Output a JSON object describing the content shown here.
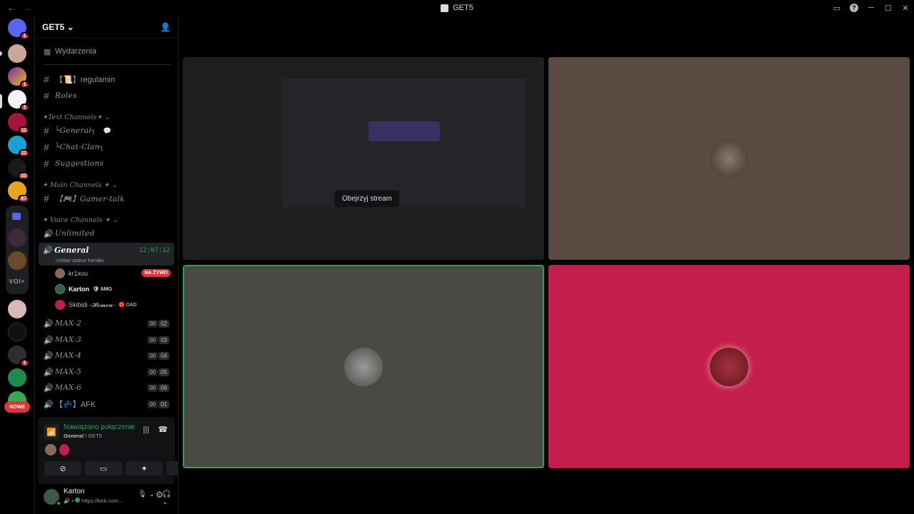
{
  "window": {
    "title": "GET5"
  },
  "server": {
    "name": "GET5"
  },
  "sidebar": {
    "events_label": "Wydarzenia",
    "channels_top": [
      {
        "label": "【📜】regulamin"
      },
      {
        "label": "Roles"
      }
    ],
    "categories": {
      "text": "✦Text Channels✦",
      "main": "✦ Main Channels ✦",
      "voice": "✦ Voice Channels ✦"
    },
    "text_channels": [
      {
        "label": "└General┐"
      },
      {
        "label": "└Chat-Clan┐"
      },
      {
        "label": "Suggestions"
      }
    ],
    "main_channels": [
      {
        "label": "【🎮】Gamer-talk"
      }
    ],
    "voice_channels": [
      {
        "label": "Unlimited"
      },
      {
        "label": "General",
        "time": "12:07:12",
        "status": "Ustaw status kanału"
      },
      {
        "label": "MAX-2",
        "count": "00",
        "limit": "02"
      },
      {
        "label": "MAX-3",
        "count": "00",
        "limit": "03"
      },
      {
        "label": "MAX-4",
        "count": "00",
        "limit": "04"
      },
      {
        "label": "MAX-5",
        "count": "00",
        "limit": "05"
      },
      {
        "label": "MAX-6",
        "count": "00",
        "limit": "06"
      },
      {
        "label": "【💤】AFK",
        "count": "00",
        "limit": "01"
      }
    ],
    "members": [
      {
        "name": "kr1xuu",
        "badge": "NA ŻYWO"
      },
      {
        "name": "Karton",
        "tag": "AMG"
      },
      {
        "name": "Skibidi -𝓗𝓮𝓶𝓮𝓷-",
        "tag": "DAD"
      }
    ]
  },
  "guild_badges": [
    "1",
    "1",
    "1",
    "11",
    "33",
    "87",
    "1"
  ],
  "guild_new": "NOWE",
  "voice_panel": {
    "status": "Nawiązano połączenie",
    "channel": "General",
    "server": "GET5"
  },
  "user": {
    "name": "Karton",
    "status": "https://kick.com..."
  },
  "stage": {
    "tooltip": "Obejrzyj stream",
    "tiles": [
      {
        "bg": "#1c1f1e"
      },
      {
        "bg": "#5a4a41"
      },
      {
        "bg": "#4b4944"
      },
      {
        "bg": "#c31e4c"
      }
    ]
  },
  "colors": {
    "green": "#23a55a",
    "red": "#da373c"
  }
}
